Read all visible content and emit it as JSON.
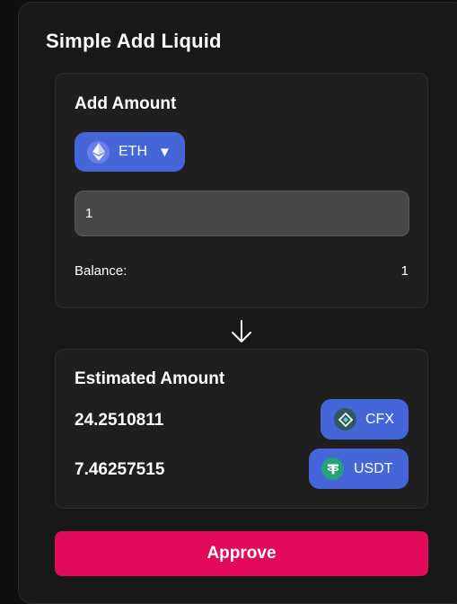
{
  "title": "Simple Add Liquid",
  "add_amount": {
    "heading": "Add Amount",
    "token": {
      "symbol": "ETH",
      "icon": "ethereum-icon",
      "caret": "▼"
    },
    "input_value": "1",
    "balance_label": "Balance:",
    "balance_value": "1"
  },
  "estimated": {
    "heading": "Estimated Amount",
    "rows": [
      {
        "value": "24.2510811",
        "symbol": "CFX",
        "icon": "conflux-icon"
      },
      {
        "value": "7.46257515",
        "symbol": "USDT",
        "icon": "tether-icon"
      }
    ]
  },
  "approve_label": "Approve",
  "colors": {
    "accent_blue": "#4565d8",
    "approve_pink": "#e30a5c",
    "card_bg": "#1f1f1f",
    "input_bg": "#474747"
  }
}
